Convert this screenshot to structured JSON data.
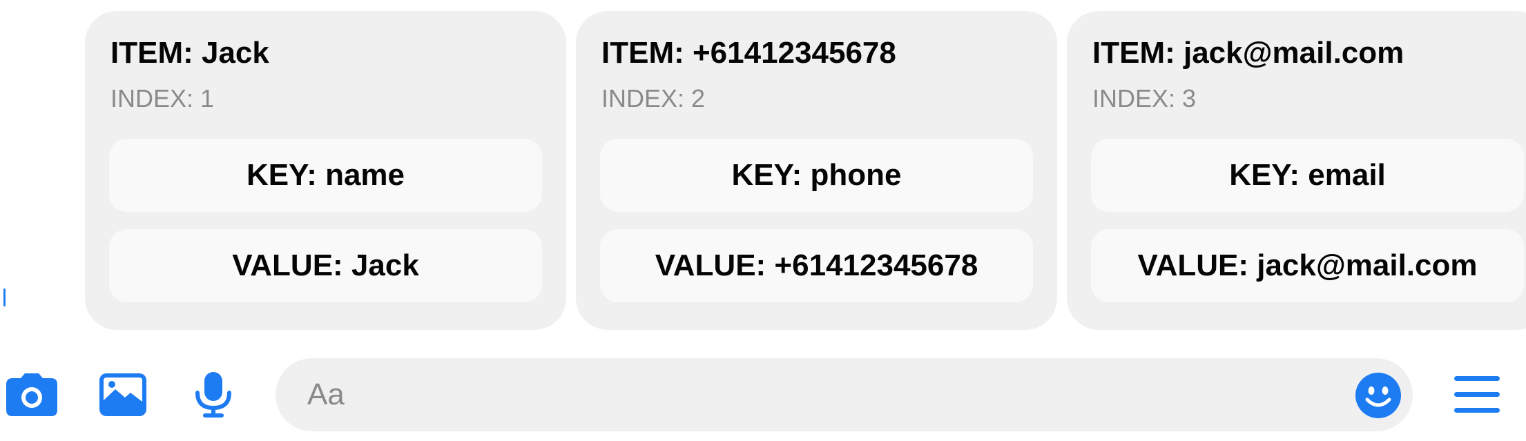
{
  "colors": {
    "accent": "#1e7cf2",
    "card_background": "#f0f0f0",
    "pill_background": "#f9f9f9",
    "secondary_text": "#8a8a8a"
  },
  "cards": [
    {
      "item": "ITEM: Jack",
      "index": "INDEX: 1",
      "key": "KEY: name",
      "value": "VALUE: Jack"
    },
    {
      "item": "ITEM: +61412345678",
      "index": "INDEX: 2",
      "key": "KEY: phone",
      "value": "VALUE: +61412345678"
    },
    {
      "item": "ITEM: jack@mail.com",
      "index": "INDEX: 3",
      "key": "KEY: email",
      "value": "VALUE: jack@mail.com"
    }
  ],
  "composer": {
    "placeholder": "Aa",
    "value": "",
    "icons": [
      "camera-icon",
      "image-icon",
      "microphone-icon",
      "emoji-icon",
      "menu-icon"
    ]
  }
}
